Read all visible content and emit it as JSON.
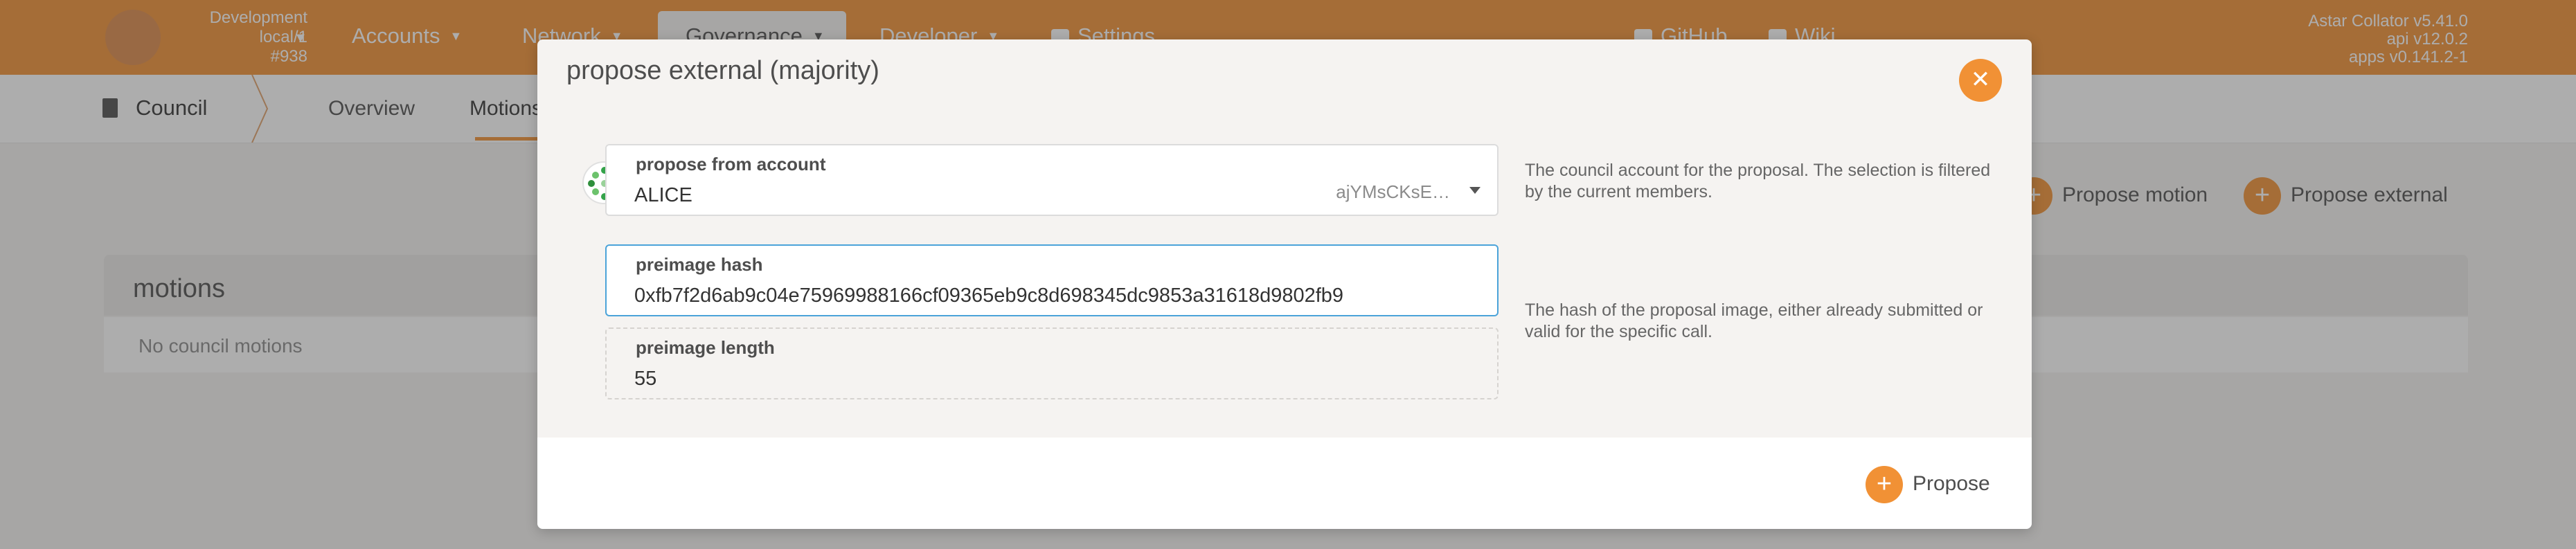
{
  "header": {
    "chain": {
      "name": "Development",
      "node": "local/1",
      "block": "#938"
    },
    "nav": [
      {
        "label": "Accounts"
      },
      {
        "label": "Network"
      },
      {
        "label": "Governance"
      },
      {
        "label": "Developer"
      },
      {
        "label": "Settings"
      },
      {
        "label": "GitHub"
      },
      {
        "label": "Wiki"
      }
    ],
    "versions": {
      "collator": "Astar Collator v5.41.0",
      "api": "api v12.0.2",
      "apps": "apps v0.141.2-1"
    }
  },
  "subnav": {
    "section": "Council",
    "tabs": [
      {
        "label": "Overview"
      },
      {
        "label": "Motions"
      }
    ]
  },
  "actions": {
    "propose_motion": "Propose motion",
    "propose_external": "Propose external"
  },
  "motions": {
    "title": "motions",
    "empty": "No council motions"
  },
  "modal": {
    "title": "propose external (majority)",
    "close_icon": "close-icon",
    "account": {
      "label": "propose from account",
      "name": "ALICE",
      "address": "ajYMsCKsE…",
      "help": "The council account for the proposal. The selection is filtered by the current members."
    },
    "preimage_hash": {
      "label": "preimage hash",
      "value": "0xfb7f2d6ab9c04e75969988166cf09365eb9c8d698345dc9853a31618d9802fb9",
      "help": "The hash of the proposal image, either already submitted or valid for the specific call."
    },
    "preimage_length": {
      "label": "preimage length",
      "value": "55"
    },
    "propose_button": "Propose"
  },
  "colors": {
    "accent": "#f19135",
    "focus": "#4ba3d9"
  }
}
